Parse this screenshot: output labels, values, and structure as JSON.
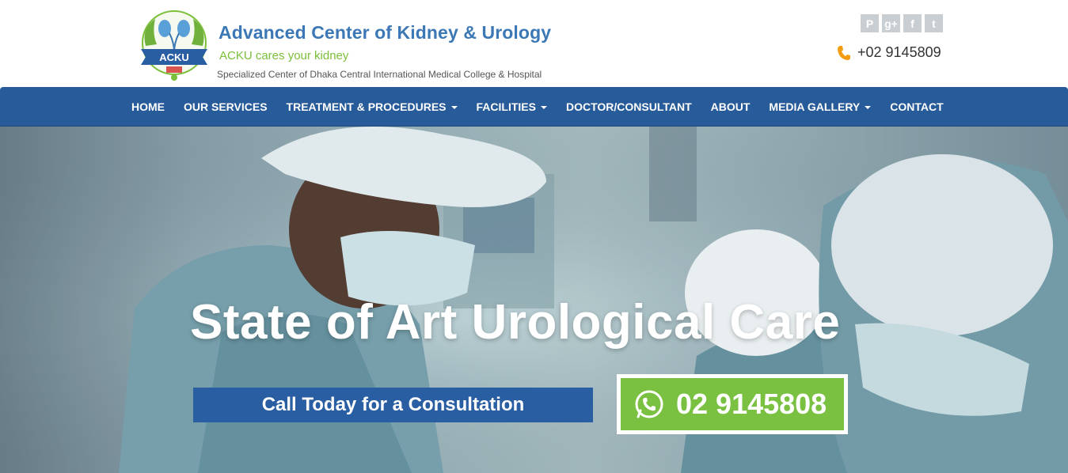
{
  "brand": {
    "logo_text": "ACKU",
    "title": "Advanced Center of Kidney & Urology",
    "tagline": "ACKU cares your kidney",
    "subtitle": "Specialized Center of  Dhaka Central International Medical College & Hospital"
  },
  "social": [
    {
      "icon": "pinterest-icon",
      "glyph": "P"
    },
    {
      "icon": "google-plus-icon",
      "glyph": "g+"
    },
    {
      "icon": "facebook-icon",
      "glyph": "f"
    },
    {
      "icon": "twitter-icon",
      "glyph": "t"
    }
  ],
  "contact": {
    "phone": "+02 9145809"
  },
  "nav": {
    "items": [
      {
        "label": "HOME"
      },
      {
        "label": "OUR SERVICES"
      },
      {
        "label": "TREATMENT & PROCEDURES"
      },
      {
        "label": "FACILITIES"
      },
      {
        "label": "DOCTOR/CONSULTANT"
      },
      {
        "label": "ABOUT"
      },
      {
        "label": "MEDIA GALLERY"
      },
      {
        "label": "CONTACT"
      }
    ]
  },
  "hero": {
    "title": "State of Art Urological Care",
    "cta_label": "Call Today for a Consultation",
    "call_number": "02 9145808"
  },
  "colors": {
    "nav_bg": "#275b99",
    "brand_blue": "#3b78b5",
    "tagline_green": "#7bbf3a",
    "call_green": "#7ac142",
    "cta_blue": "#2a5ea3",
    "phone_icon_orange": "#f39c12"
  }
}
